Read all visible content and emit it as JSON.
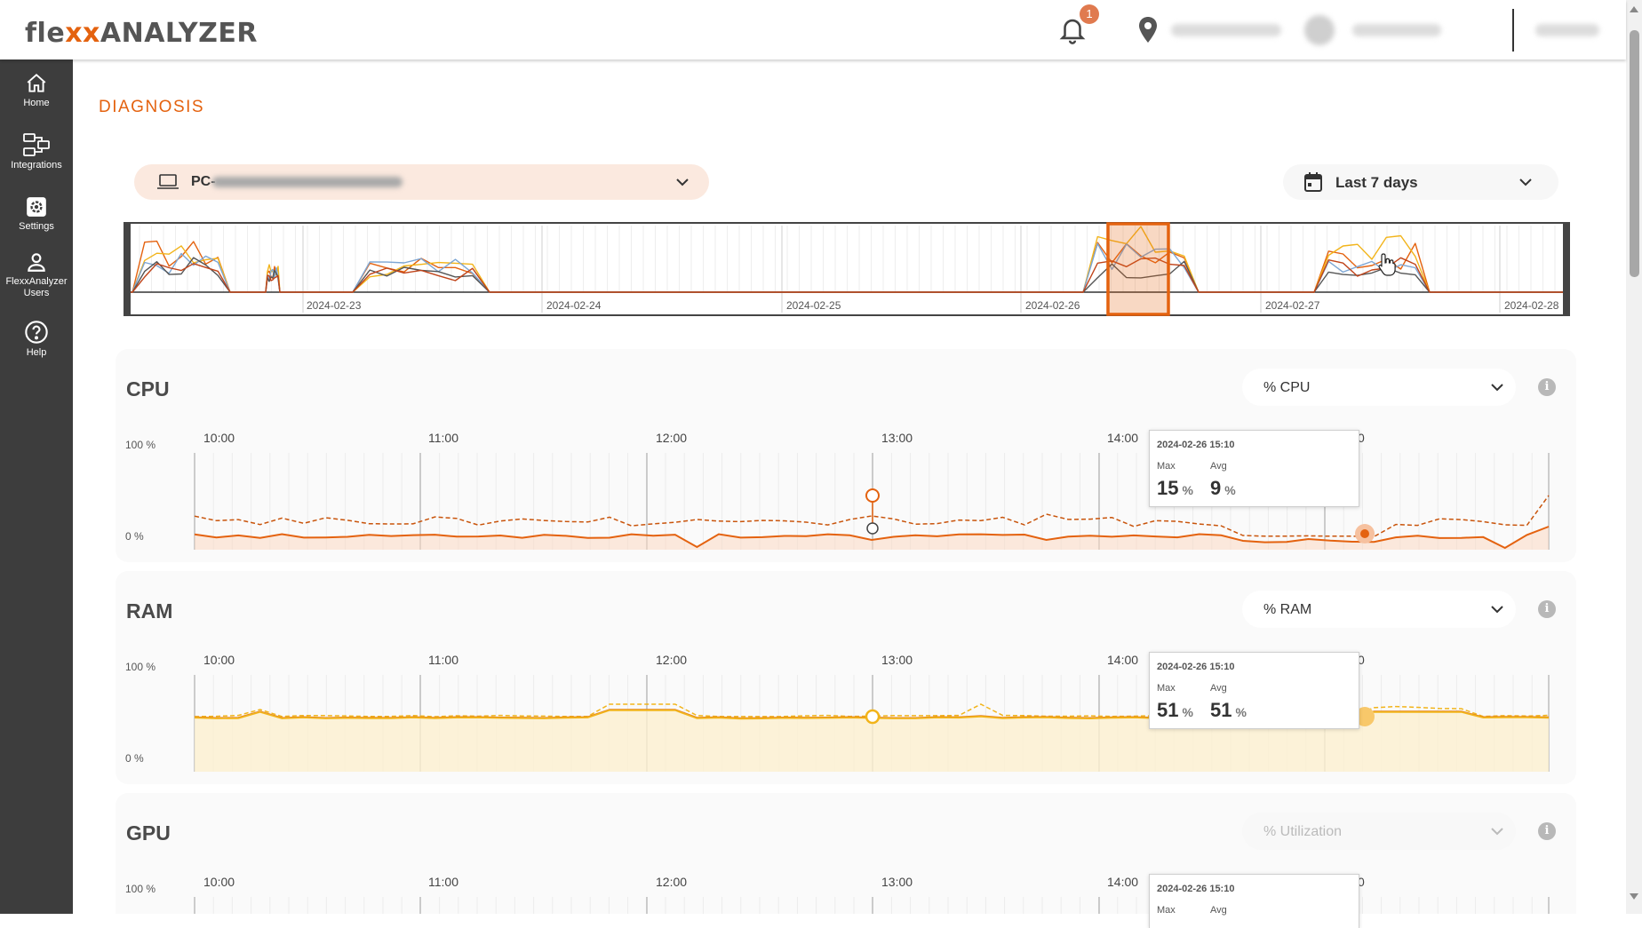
{
  "app": {
    "logo_prefix": "fle",
    "logo_mark": "xx",
    "logo_suffix": "ANALYZER",
    "notification_count": "1"
  },
  "sidebar": {
    "items": [
      {
        "label_lines": [
          "Home"
        ],
        "icon": "home-icon"
      },
      {
        "label_lines": [
          "Integrations"
        ],
        "icon": "integrations-icon"
      },
      {
        "label_lines": [
          "Settings"
        ],
        "icon": "settings-icon"
      },
      {
        "label_lines": [
          "FlexxAnalyzer",
          "Users"
        ],
        "icon": "user-icon"
      },
      {
        "label_lines": [
          "Help"
        ],
        "icon": "help-icon"
      }
    ]
  },
  "page": {
    "title": "DIAGNOSIS"
  },
  "device_select": {
    "value": "PC-"
  },
  "date_select": {
    "value": "Last 7 days"
  },
  "overview": {
    "dates": [
      "2024-02-23",
      "2024-02-24",
      "2024-02-25",
      "2024-02-26",
      "2024-02-27",
      "2024-02-28"
    ]
  },
  "colors": {
    "accent": "#e4620f",
    "cpu_line": "#e4620f",
    "ram_line": "#f2b41a",
    "ram_line_dark": "#e07a20",
    "gpu_line": "#7da6d4",
    "sidebar_bg": "#3d3d3d"
  },
  "panels": [
    {
      "title": "CPU",
      "metric": "% CPU",
      "y_max": "100 %",
      "y_min": "0 %",
      "times": [
        "10:00",
        "11:00",
        "12:00",
        "13:00",
        "14:00",
        "0"
      ],
      "tooltip": {
        "date": "2024-02-26 15:10",
        "max_label": "Max",
        "avg_label": "Avg",
        "max": "15",
        "avg": "9",
        "unit": "%"
      }
    },
    {
      "title": "RAM",
      "metric": "% RAM",
      "y_max": "100 %",
      "y_min": "0 %",
      "times": [
        "10:00",
        "11:00",
        "12:00",
        "13:00",
        "14:00",
        "0"
      ],
      "tooltip": {
        "date": "2024-02-26 15:10",
        "max_label": "Max",
        "avg_label": "Avg",
        "max": "51",
        "avg": "51",
        "unit": "%"
      }
    },
    {
      "title": "GPU",
      "metric": "% Utilization",
      "y_max": "100 %",
      "y_min": "",
      "times": [
        "10:00",
        "11:00",
        "12:00",
        "13:00",
        "14:00",
        "0"
      ],
      "tooltip": {
        "date": "2024-02-26 15:10",
        "max_label": "Max",
        "avg_label": "Avg",
        "max": "",
        "avg": "",
        "unit": ""
      }
    }
  ]
}
